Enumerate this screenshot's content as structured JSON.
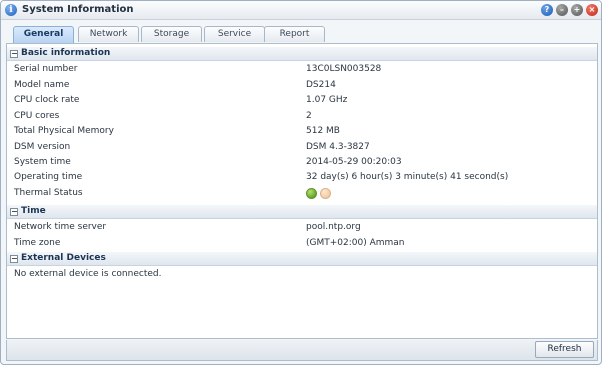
{
  "window": {
    "title": "System Information",
    "app_icon": "info-icon",
    "controls": [
      "help-icon",
      "minimize-icon",
      "maximize-icon",
      "close-icon"
    ]
  },
  "tabs": [
    {
      "label": "General",
      "active": true
    },
    {
      "label": "Network",
      "active": false
    },
    {
      "label": "Storage",
      "active": false
    },
    {
      "label": "Service",
      "active": false
    },
    {
      "label": "Report",
      "active": false
    }
  ],
  "sections": {
    "basic": {
      "title": "Basic information",
      "rows": [
        {
          "key": "Serial number",
          "value": "13C0LSN003528"
        },
        {
          "key": "Model name",
          "value": "DS214"
        },
        {
          "key": "CPU clock rate",
          "value": "1.07 GHz"
        },
        {
          "key": "CPU cores",
          "value": "2"
        },
        {
          "key": "Total Physical Memory",
          "value": "512 MB"
        },
        {
          "key": "DSM version",
          "value": "DSM 4.3-3827"
        },
        {
          "key": "System time",
          "value": "2014-05-29 00:20:03"
        },
        {
          "key": "Operating time",
          "value": "32 day(s) 6 hour(s) 3 minute(s) 41 second(s)"
        },
        {
          "key": "Thermal Status",
          "value": ""
        }
      ],
      "thermal_indicators": [
        {
          "state": "normal",
          "color": "#3d8f16"
        },
        {
          "state": "warning",
          "color": "#f0c08f"
        }
      ]
    },
    "time": {
      "title": "Time",
      "rows": [
        {
          "key": "Network time server",
          "value": "pool.ntp.org"
        },
        {
          "key": "Time zone",
          "value": "(GMT+02:00) Amman"
        }
      ]
    },
    "external": {
      "title": "External Devices",
      "message": "No external device is connected."
    }
  },
  "footer": {
    "refresh_label": "Refresh"
  }
}
